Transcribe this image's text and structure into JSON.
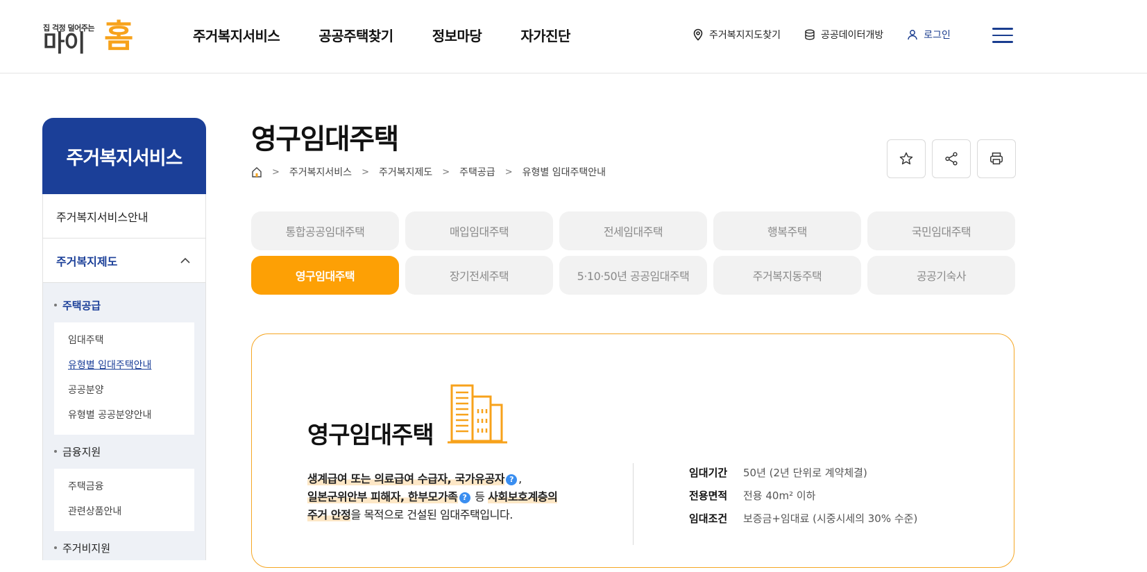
{
  "header": {
    "logo_tagline": "집 걱정 덜어주는",
    "logo_word": "마이",
    "logo_home": "홈",
    "nav": [
      "주거복지서비스",
      "공공주택찾기",
      "정보마당",
      "자가진단"
    ],
    "util": {
      "map_label": "주거복지지도찾기",
      "data_label": "공공데이터개방",
      "login_label": "로그인"
    }
  },
  "sidebar": {
    "title": "주거복지서비스",
    "item_guide": "주거복지서비스안내",
    "item_system": "주거복지제도",
    "groups": [
      {
        "label": "주택공급",
        "links": [
          "임대주택",
          "유형별 임대주택안내",
          "공공분양",
          "유형별 공공분양안내"
        ]
      },
      {
        "label": "금융지원",
        "links": [
          "주택금융",
          "관련상품안내"
        ]
      },
      {
        "label": "주거비지원",
        "links": []
      }
    ]
  },
  "page": {
    "title": "영구임대주택",
    "breadcrumb": [
      "주거복지서비스",
      "주거복지제도",
      "주택공급",
      "유형별 임대주택안내"
    ]
  },
  "tabs": [
    "통합공공임대주택",
    "매입임대주택",
    "전세임대주택",
    "행복주택",
    "국민임대주택",
    "영구임대주택",
    "장기전세주택",
    "5·10·50년 공공임대주택",
    "주거복지동주택",
    "공공기숙사"
  ],
  "active_tab_index": 5,
  "card": {
    "title": "영구임대주택",
    "desc_1": "생계급여 또는 의료급여 수급자, 국가유공자",
    "desc_2": "일본군위안부 피해자, 한부모가족",
    "desc_3": "등",
    "desc_4": "사회보호계층의",
    "desc_5": "주거 안정",
    "desc_6": "을 목적으로 건설된 임대주택입니다.",
    "help": "?",
    "info": [
      {
        "k": "임대기간",
        "v": "50년 (2년 단위로 계약체결)"
      },
      {
        "k": "전용면적",
        "v": "전용 40m² 이하"
      },
      {
        "k": "임대조건",
        "v": "보증금+임대료 (시중시세의 30% 수준)"
      }
    ]
  },
  "colors": {
    "primary_blue": "#1b3f98",
    "accent_orange": "#fda005",
    "help_blue": "#3a8ef0"
  }
}
